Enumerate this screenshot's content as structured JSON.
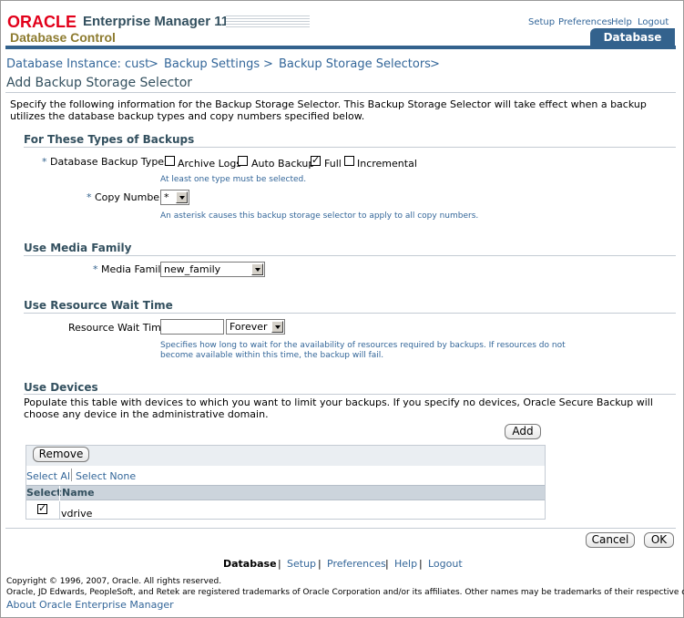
{
  "header": {
    "brand_oracle": "ORACLE",
    "brand_product": "Enterprise Manager 11",
    "brand_product_suffix": "g",
    "brand_subtitle": "Database Control",
    "links": [
      "Setup",
      "Preferences",
      "Help",
      "Logout"
    ],
    "active_tab": "Database"
  },
  "breadcrumb": [
    "Database Instance: cust",
    "Backup Settings",
    "Backup Storage Selectors"
  ],
  "breadcrumb_separator": ">",
  "page_title": "Add Backup Storage Selector",
  "description": "Specify the following information for the Backup Storage Selector. This Backup Storage Selector will take effect when a backup utilizes the database backup types and copy numbers specified below.",
  "section_types": {
    "heading": "For These Types of Backups",
    "backup_types_label": "Database Backup Types",
    "options": [
      {
        "label": "Archive Logs",
        "checked": false
      },
      {
        "label": "Auto Backup",
        "checked": false
      },
      {
        "label": "Full",
        "checked": true
      },
      {
        "label": "Incremental",
        "checked": false
      }
    ],
    "types_hint": "At least one type must be selected.",
    "copy_number_label": "Copy Number",
    "copy_number_value": "*",
    "copy_number_hint": "An asterisk causes this backup storage selector to apply to all copy numbers."
  },
  "section_media": {
    "heading": "Use Media Family",
    "label": "Media Family",
    "value": "new_family"
  },
  "section_wait": {
    "heading": "Use Resource Wait Time",
    "label": "Resource Wait Time",
    "text_value": "",
    "unit_value": "Forever",
    "hint_line1": "Specifies how long to wait for the availability of resources required by backups. If resources do not",
    "hint_line2": "become available within this time, the backup will fail."
  },
  "section_devices": {
    "heading": "Use Devices",
    "description": "Populate this table with devices to which you want to limit your backups. If you specify no devices, Oracle Secure Backup will choose any device in the administrative domain.",
    "add_button": "Add",
    "remove_button": "Remove",
    "select_all": "Select All",
    "select_none": "Select None",
    "columns": [
      "Select",
      "Name"
    ],
    "rows": [
      {
        "selected": true,
        "name": "vdrive"
      }
    ]
  },
  "actions": {
    "cancel": "Cancel",
    "ok": "OK"
  },
  "footer": {
    "links": [
      "Database",
      "Setup",
      "Preferences",
      "Help",
      "Logout"
    ],
    "copyright": "Copyright © 1996, 2007, Oracle. All rights reserved.",
    "trademark": "Oracle, JD Edwards, PeopleSoft, and Retek are registered trademarks of Oracle Corporation and/or its affiliates. Other names may be trademarks of their respective owners.",
    "about": "About Oracle Enterprise Manager"
  },
  "colors": {
    "brand_red": "#e2001a",
    "tab_blue": "#33628d",
    "link_blue": "#336699",
    "heading": "#33505f"
  }
}
